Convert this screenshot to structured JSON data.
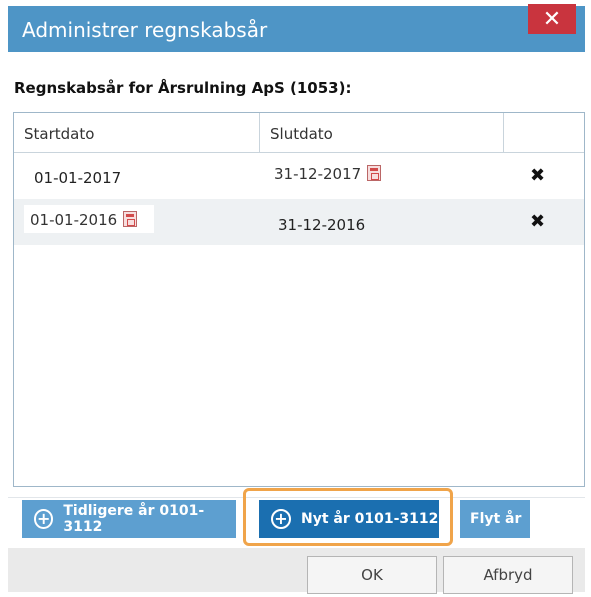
{
  "window": {
    "title": "Administrer regnskabsår",
    "close_label": "✕"
  },
  "subtitle": "Regnskabsår for Årsrulning ApS (1053):",
  "grid": {
    "columns": [
      "Startdato",
      "Slutdato",
      ""
    ],
    "rows": [
      {
        "start": "01-01-2017",
        "end": "31-12-2017",
        "delete": "✖"
      },
      {
        "start": "01-01-2016",
        "end": "31-12-2016",
        "delete": "✖"
      }
    ]
  },
  "actions": {
    "earlier_year": "Tidligere år 0101-3112",
    "new_year": "Nyt år 0101-3112",
    "move_year": "Flyt år"
  },
  "footer": {
    "ok": "OK",
    "cancel": "Afbryd"
  },
  "icons": {
    "plus": "plus-circle-icon",
    "calendar": "calendar-icon",
    "delete": "delete-x-icon",
    "close": "close-icon"
  },
  "colors": {
    "titlebar": "#4e95c6",
    "close": "#c9343e",
    "button": "#5d9fd0",
    "primary_button": "#1b6fb0",
    "highlight": "#f0a44a"
  }
}
